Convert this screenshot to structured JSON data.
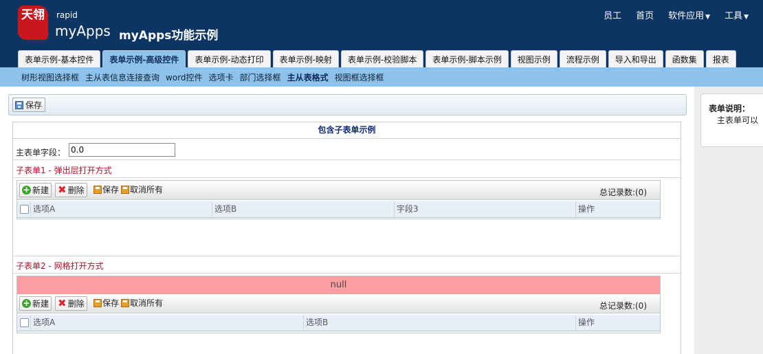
{
  "header": {
    "logo_text": "天翎",
    "brand_small": "rapid",
    "brand_big": "myApps",
    "app_title": "myApps功能示例",
    "nav": [
      {
        "label": "员工"
      },
      {
        "label": "首页"
      },
      {
        "label": "软件应用",
        "caret": "▼"
      },
      {
        "label": "工具",
        "caret": "▼"
      }
    ]
  },
  "main_tabs": [
    {
      "label": "表单示例-基本控件",
      "active": false
    },
    {
      "label": "表单示例-高级控件",
      "active": true
    },
    {
      "label": "表单示例-动态打印",
      "active": false
    },
    {
      "label": "表单示例-映射",
      "active": false
    },
    {
      "label": "表单示例-校验脚本",
      "active": false
    },
    {
      "label": "表单示例-脚本示例",
      "active": false
    },
    {
      "label": "视图示例",
      "active": false
    },
    {
      "label": "流程示例",
      "active": false
    },
    {
      "label": "导入和导出",
      "active": false
    },
    {
      "label": "函数集",
      "active": false
    },
    {
      "label": "报表",
      "active": false
    }
  ],
  "sub_nav": [
    {
      "label": "树形视图选择框",
      "active": false
    },
    {
      "label": "主从表信息连接查询",
      "active": false
    },
    {
      "label": "word控件",
      "active": false
    },
    {
      "label": "选项卡",
      "active": false
    },
    {
      "label": "部门选择框",
      "active": false
    },
    {
      "label": "主从表格式",
      "active": true
    },
    {
      "label": "视图框选择框",
      "active": false
    }
  ],
  "toolbar": {
    "save_label": "保存"
  },
  "form": {
    "title": "包含子表单示例",
    "main_field_label": "主表单字段：",
    "main_field_value": "0.0"
  },
  "subform1": {
    "title": "子表单1 - 弹出层打开方式",
    "new_label": "新建",
    "delete_label": "删除",
    "save_label": "保存",
    "cancel_label": "取消所有",
    "record_count": "总记录数:(0)",
    "columns": [
      "选项A",
      "选项B",
      "字段3",
      "操作"
    ]
  },
  "subform2": {
    "title": "子表单2 - 网格打开方式",
    "null_text": "null",
    "new_label": "新建",
    "delete_label": "删除",
    "save_label": "保存",
    "cancel_label": "取消所有",
    "record_count": "总记录数:(0)",
    "columns": [
      "选项A",
      "选项B",
      "操作"
    ]
  },
  "right_panel": {
    "desc_title": "表单说明：",
    "desc_text": "主表单可以"
  },
  "colors": {
    "header_bg": "#0d3564",
    "subnav_bg": "#8dc2ec",
    "active_tab_bg": "#8dc2ec",
    "subform_title": "#b0102a",
    "null_bar": "#ff9ea2"
  }
}
